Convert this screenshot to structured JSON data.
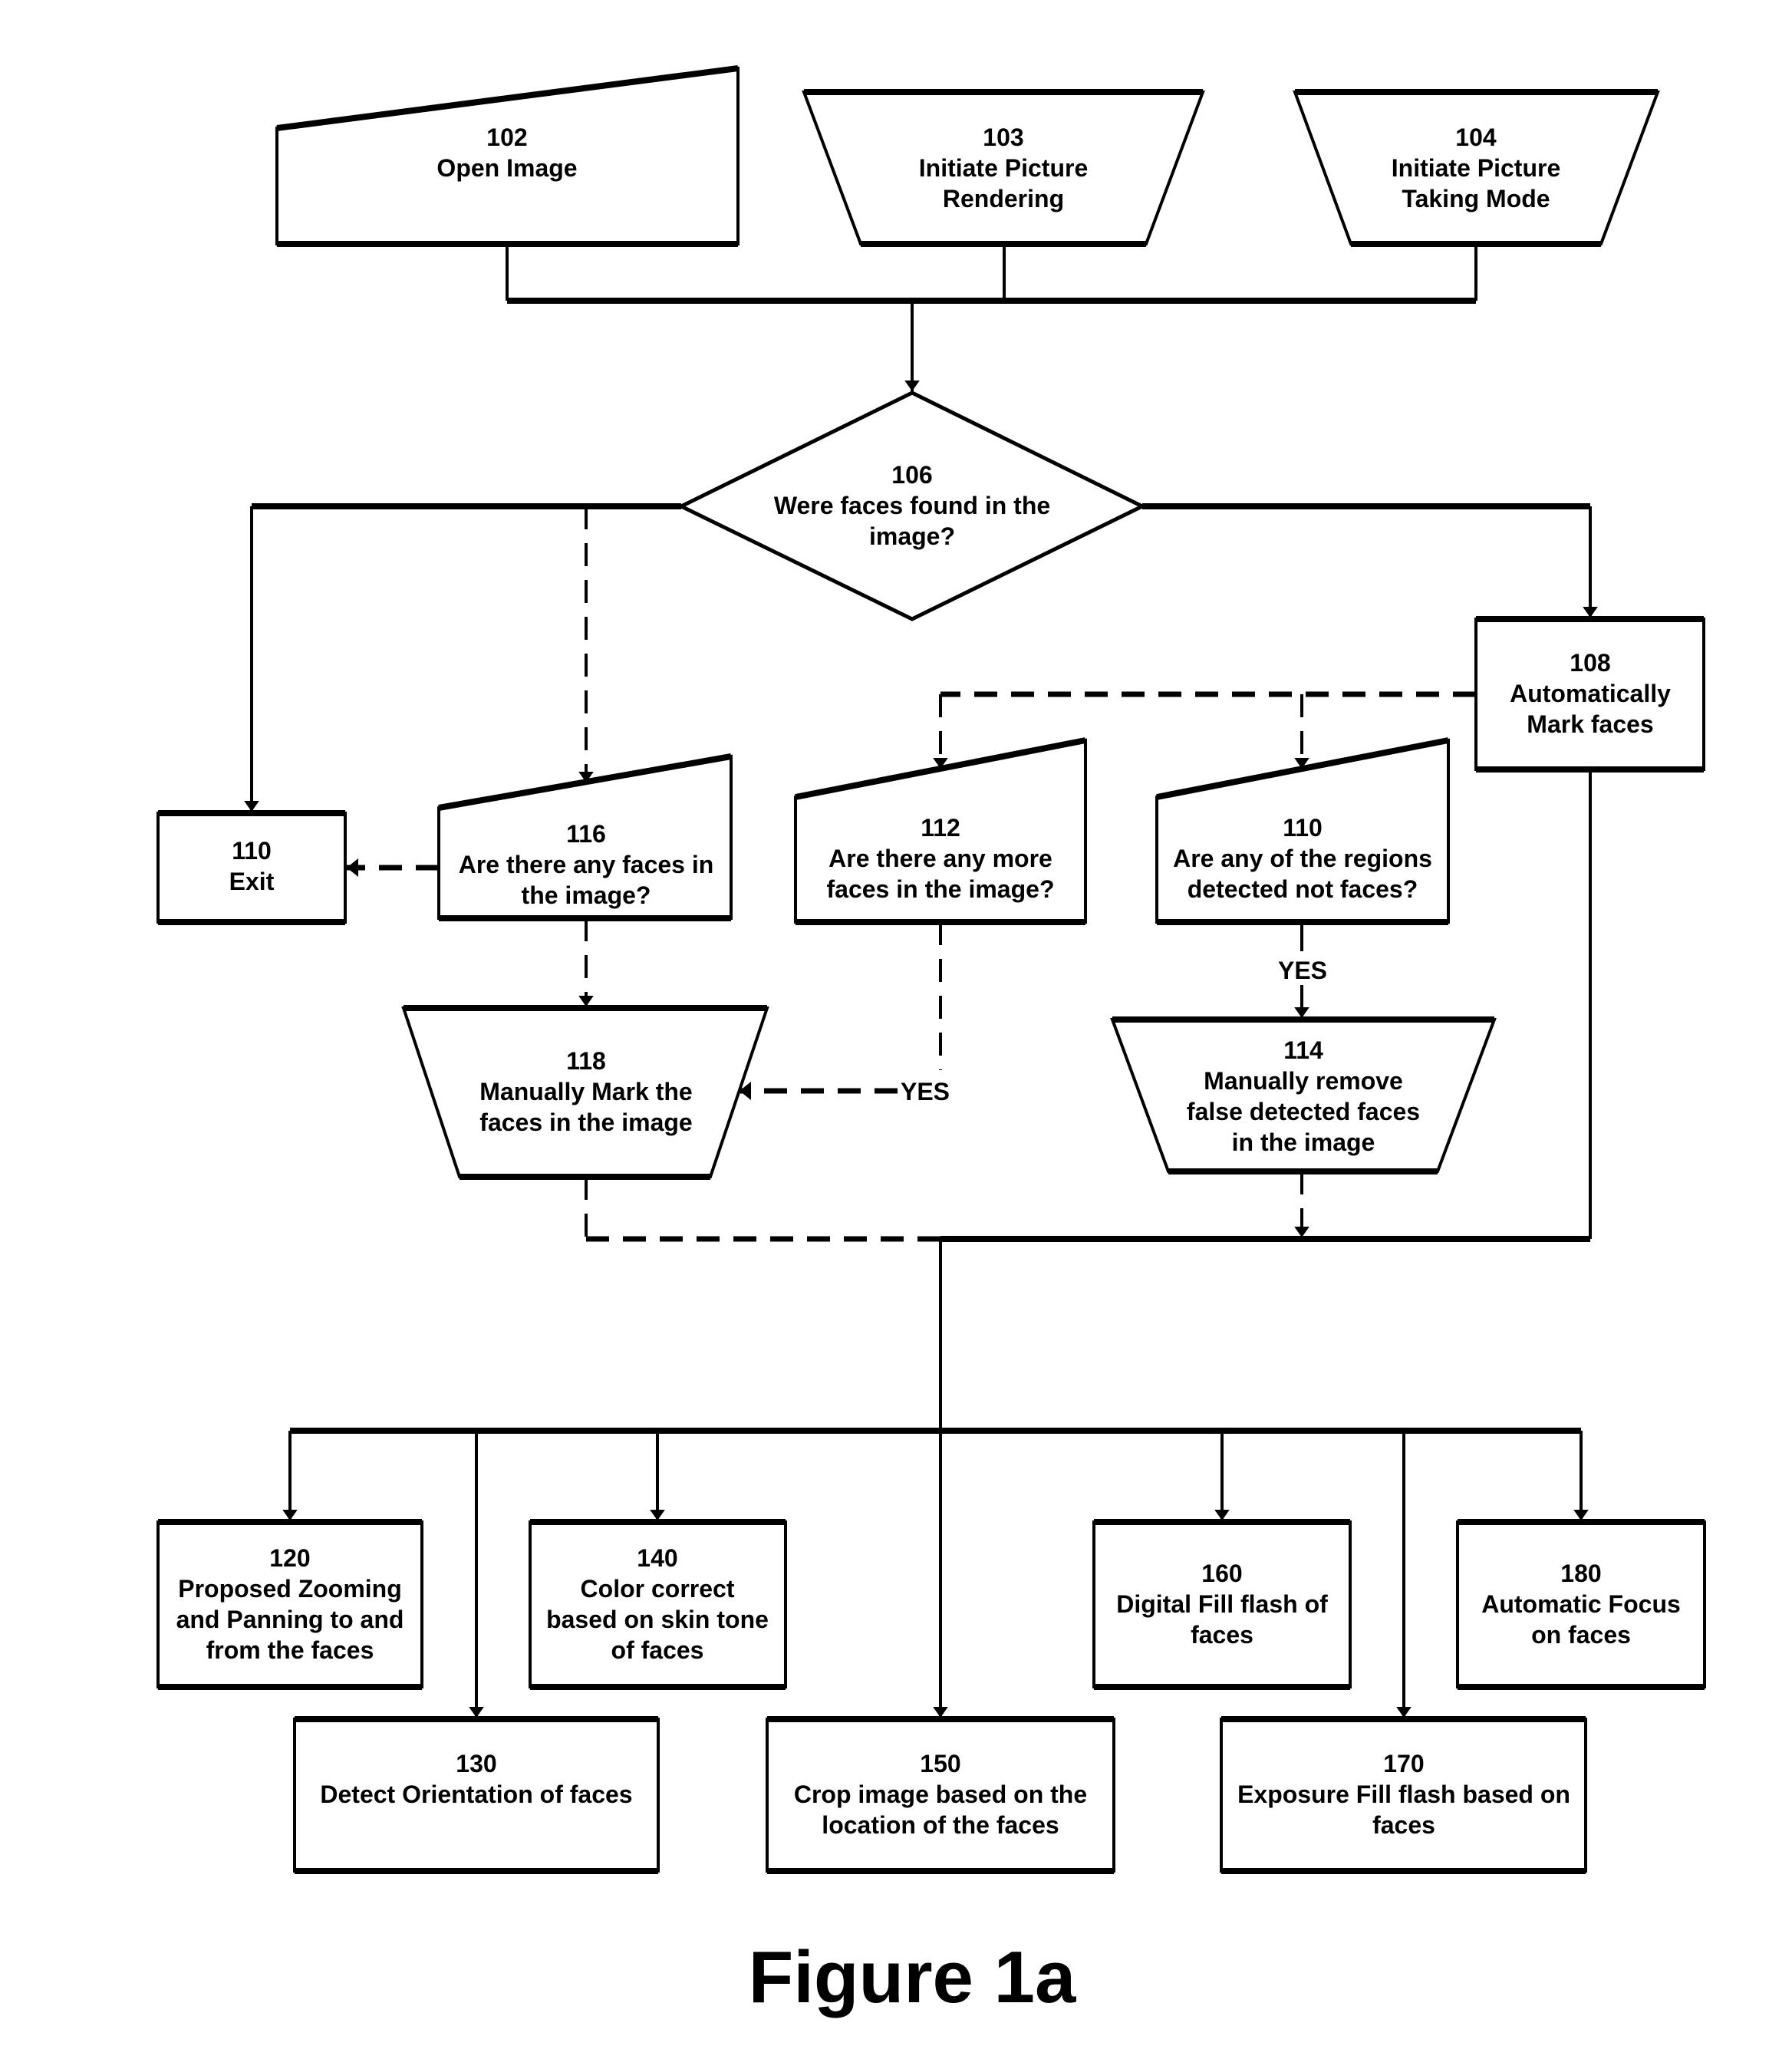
{
  "figure_title": "Figure 1a",
  "nodes": {
    "n102": {
      "id": "102",
      "lines": [
        "Open Image"
      ]
    },
    "n103": {
      "id": "103",
      "lines": [
        "Initiate Picture",
        "Rendering"
      ]
    },
    "n104": {
      "id": "104",
      "lines": [
        "Initiate Picture",
        "Taking Mode"
      ]
    },
    "n106": {
      "id": "106",
      "lines": [
        "Were faces found in the",
        "image?"
      ]
    },
    "n108": {
      "id": "108",
      "lines": [
        "Automatically",
        "Mark faces"
      ]
    },
    "n110exit": {
      "id": "110",
      "lines": [
        "Exit"
      ]
    },
    "n116": {
      "id": "116",
      "lines": [
        "Are there any faces in",
        "the image?"
      ]
    },
    "n112": {
      "id": "112",
      "lines": [
        "Are there any more",
        "faces in the image?"
      ]
    },
    "n110q": {
      "id": "110",
      "lines": [
        "Are any of the regions",
        "detected not faces?"
      ]
    },
    "n118": {
      "id": "118",
      "lines": [
        "Manually Mark the",
        "faces in the image"
      ]
    },
    "n114": {
      "id": "114",
      "lines": [
        "Manually remove",
        "false detected faces",
        "in the image"
      ]
    },
    "n120": {
      "id": "120",
      "lines": [
        "Proposed Zooming",
        "and Panning to and",
        "from the faces"
      ]
    },
    "n130": {
      "id": "130",
      "lines": [
        "Detect Orientation of faces"
      ]
    },
    "n140": {
      "id": "140",
      "lines": [
        "Color correct",
        "based on skin tone",
        "of faces"
      ]
    },
    "n150": {
      "id": "150",
      "lines": [
        "Crop image based on the",
        "location of the faces"
      ]
    },
    "n160": {
      "id": "160",
      "lines": [
        "Digital Fill flash of",
        "faces"
      ]
    },
    "n170": {
      "id": "170",
      "lines": [
        "Exposure Fill flash based on",
        "faces"
      ]
    },
    "n180": {
      "id": "180",
      "lines": [
        "Automatic Focus",
        "on faces"
      ]
    }
  },
  "edge_labels": {
    "yes_112_to_118": "YES",
    "yes_110_to_114": "YES"
  }
}
